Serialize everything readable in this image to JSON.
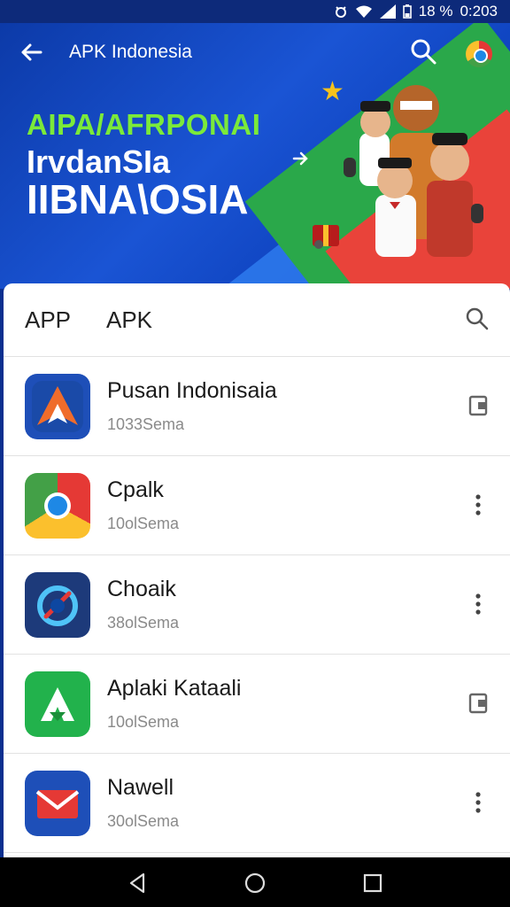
{
  "status_bar": {
    "battery_percent": "18 %",
    "time": "0:203"
  },
  "app_bar": {
    "title": "APK Indonesia"
  },
  "hero": {
    "line1": "AIPA/AFRPONAI",
    "line2": "IrvdanSIa",
    "line3": "IIBNA\\OSIA"
  },
  "sheet": {
    "tabs": [
      "APP",
      "APK"
    ]
  },
  "apps": [
    {
      "name": "Pusan Indonisaia",
      "sub": "1033Sema",
      "icon": "arrow-a-icon",
      "action": "book-icon"
    },
    {
      "name": "Cpalk",
      "sub": "10olSema",
      "icon": "chrome-icon",
      "action": "more-vert-icon"
    },
    {
      "name": "Choaik",
      "sub": "38olSema",
      "icon": "compass-icon",
      "action": "more-vert-icon"
    },
    {
      "name": "Aplaki Kataali",
      "sub": "10olSema",
      "icon": "green-a-icon",
      "action": "book-icon"
    },
    {
      "name": "Nawell",
      "sub": "30olSema",
      "icon": "mail-icon",
      "action": "more-vert-icon"
    }
  ],
  "colors": {
    "hero_blue": "#0c3aa8",
    "accent_green": "#7bea3a"
  }
}
